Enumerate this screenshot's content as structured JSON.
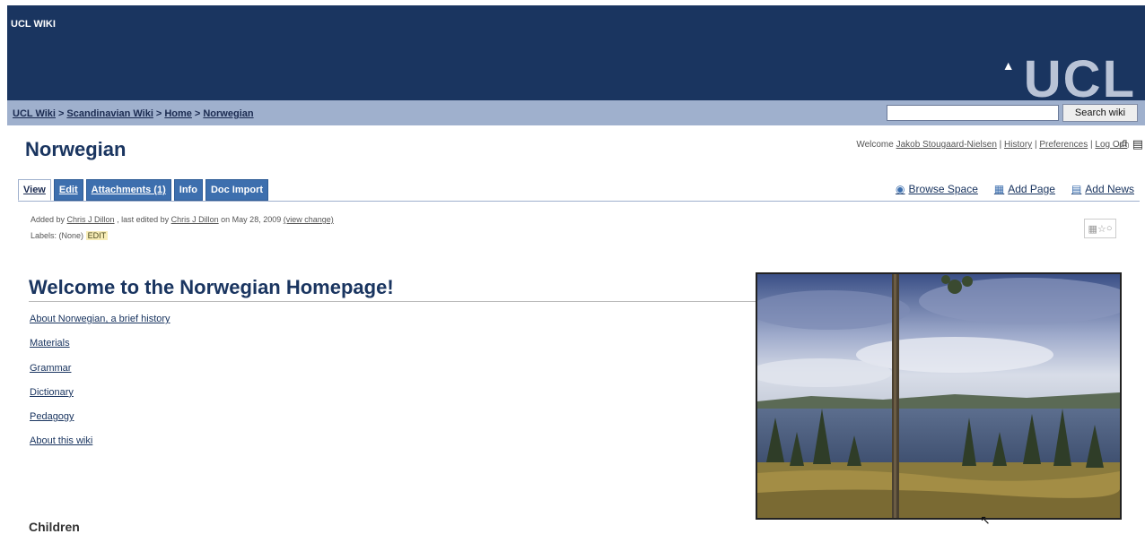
{
  "header": {
    "app_title": "UCL WIKI",
    "logo_text": "UCL"
  },
  "breadcrumb": [
    "UCL Wiki",
    "Scandinavian Wiki",
    "Home",
    "Norwegian"
  ],
  "breadcrumb_sep": ">",
  "search": {
    "value": "",
    "placeholder": "",
    "button_label": "Search wiki"
  },
  "page": {
    "title": "Norwegian"
  },
  "user_bar": {
    "welcome": "Welcome",
    "user_name": "Jakob Stougaard-Nielsen",
    "history": "History",
    "preferences": "Preferences",
    "logout": "Log Out"
  },
  "tabs": [
    {
      "label": "View",
      "active": true
    },
    {
      "label": "Edit",
      "active": false
    },
    {
      "label": "Attachments (1)",
      "active": false
    },
    {
      "label": "Info",
      "active": false
    },
    {
      "label": "Doc Import",
      "active": false
    }
  ],
  "actions": {
    "browse_space": "Browse Space",
    "add_page": "Add Page",
    "add_news": "Add News"
  },
  "meta": {
    "added_by_prefix": "Added by",
    "added_by": "Chris J Dillon",
    "edited_prefix": ", last edited by",
    "edited_by": "Chris J Dillon",
    "edited_on": "on May 28, 2009",
    "view_change": "(view change)",
    "labels_prefix": "Labels:",
    "labels_value": "(None)",
    "labels_edit": "EDIT"
  },
  "content": {
    "heading": "Welcome to the Norwegian Homepage!",
    "links": [
      "About Norwegian, a brief history",
      "Materials",
      "Grammar",
      "Dictionary",
      "Pedagogy",
      "About this wiki"
    ],
    "children_heading": "Children"
  },
  "colors": {
    "header_bg": "#1a3560",
    "breadcrumb_bg": "#9fb0cd",
    "tab_bg": "#3d6fae",
    "title_color": "#1a3560"
  },
  "icons": {
    "print": "print-icon",
    "pdf": "pdf-export-icon",
    "browse_space": "globe-icon",
    "add_page": "add-page-icon",
    "add_news": "add-news-icon",
    "page_tools": [
      "page-layout-icon",
      "favourite-star-icon",
      "watch-icon"
    ]
  }
}
